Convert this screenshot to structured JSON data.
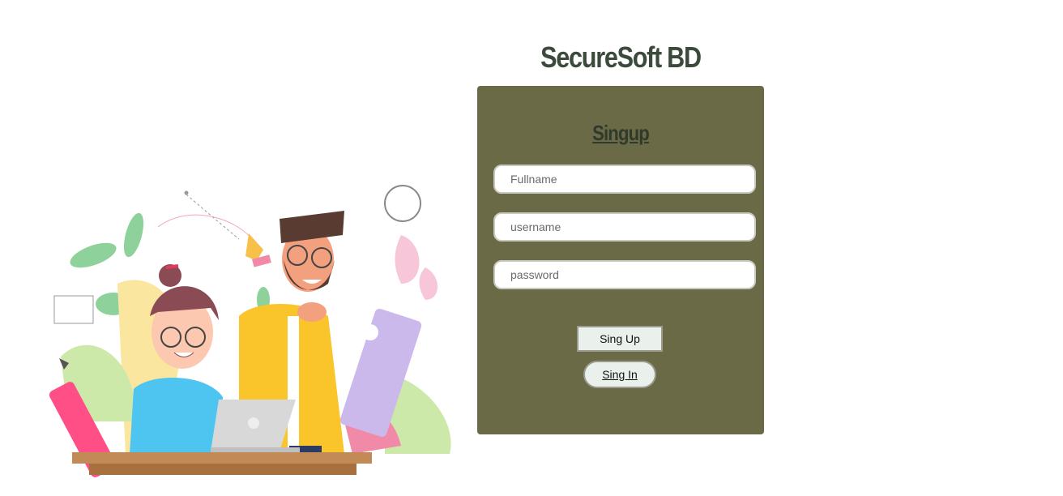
{
  "brand": {
    "title": "SecureSoft BD"
  },
  "form": {
    "title": "Singup",
    "fields": [
      {
        "placeholder": "Fullname"
      },
      {
        "placeholder": "username"
      },
      {
        "placeholder": "password"
      }
    ],
    "signup_label": "Sing Up",
    "signin_label": "Sing In"
  },
  "colors": {
    "card_bg": "#6b6a46",
    "heading": "#3b4a3a",
    "button_bg": "#eaf1ec"
  },
  "illustration": {
    "icon": "people-with-laptop-illustration"
  }
}
